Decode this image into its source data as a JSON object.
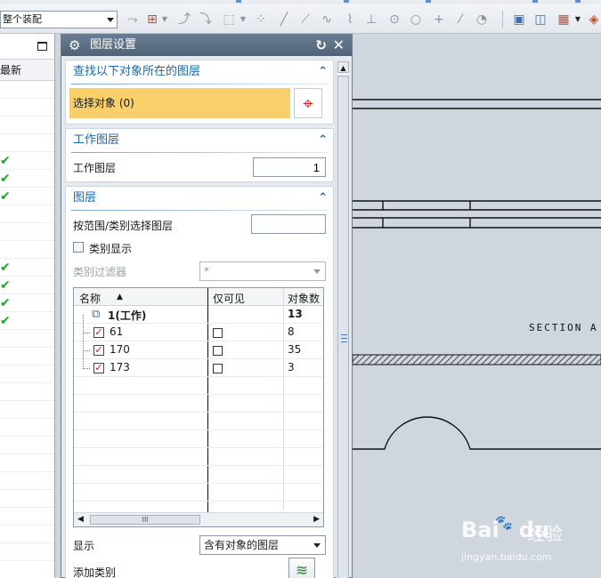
{
  "toolbar": {
    "assembly_filter": "整个装配",
    "icons": [
      "snap-icon",
      "select-filter-icon",
      "curve-icon",
      "point-icon",
      "rectangle-select-icon",
      "multi-point-icon",
      "line-icon",
      "segment-icon",
      "spline-icon",
      "studio-icon",
      "axis-icon",
      "circle-icon",
      "circle-outline-icon",
      "plus-icon",
      "slash-icon",
      "arc-icon",
      "view-icon",
      "window-icon",
      "layout-icon",
      "dropdown-icon",
      "tools-icon"
    ]
  },
  "navigator": {
    "column_header": "最新",
    "checked_rows": [
      4,
      5,
      6,
      10,
      11,
      12,
      13
    ]
  },
  "dialog": {
    "title": "图层设置",
    "find_group": {
      "title": "查找以下对象所在的图层",
      "select_label": "选择对象 (0)"
    },
    "work_group": {
      "title": "工作图层",
      "field_label": "工作图层",
      "value": "1"
    },
    "layers_group": {
      "title": "图层",
      "range_label": "按范围/类别选择图层",
      "range_value": "",
      "category_display_label": "类别显示",
      "category_filter_label": "类别过滤器",
      "category_filter_value": "*",
      "columns": [
        "名称",
        "仅可见",
        "对象数"
      ],
      "rows": [
        {
          "name": "1(工作)",
          "count": "13",
          "work": true
        },
        {
          "name": "61",
          "count": "8"
        },
        {
          "name": "170",
          "count": "35"
        },
        {
          "name": "173",
          "count": "3"
        }
      ],
      "scroll_grip": "III",
      "display_label": "显示",
      "display_value": "含有对象的图层",
      "add_category_label": "添加类别"
    }
  },
  "canvas": {
    "section_label": "SECTION A"
  },
  "watermark": {
    "logo": "Bai",
    "logo2": "du",
    "paw": "🐾",
    "cn": "经验",
    "url": "jingyan.baidu.com"
  }
}
